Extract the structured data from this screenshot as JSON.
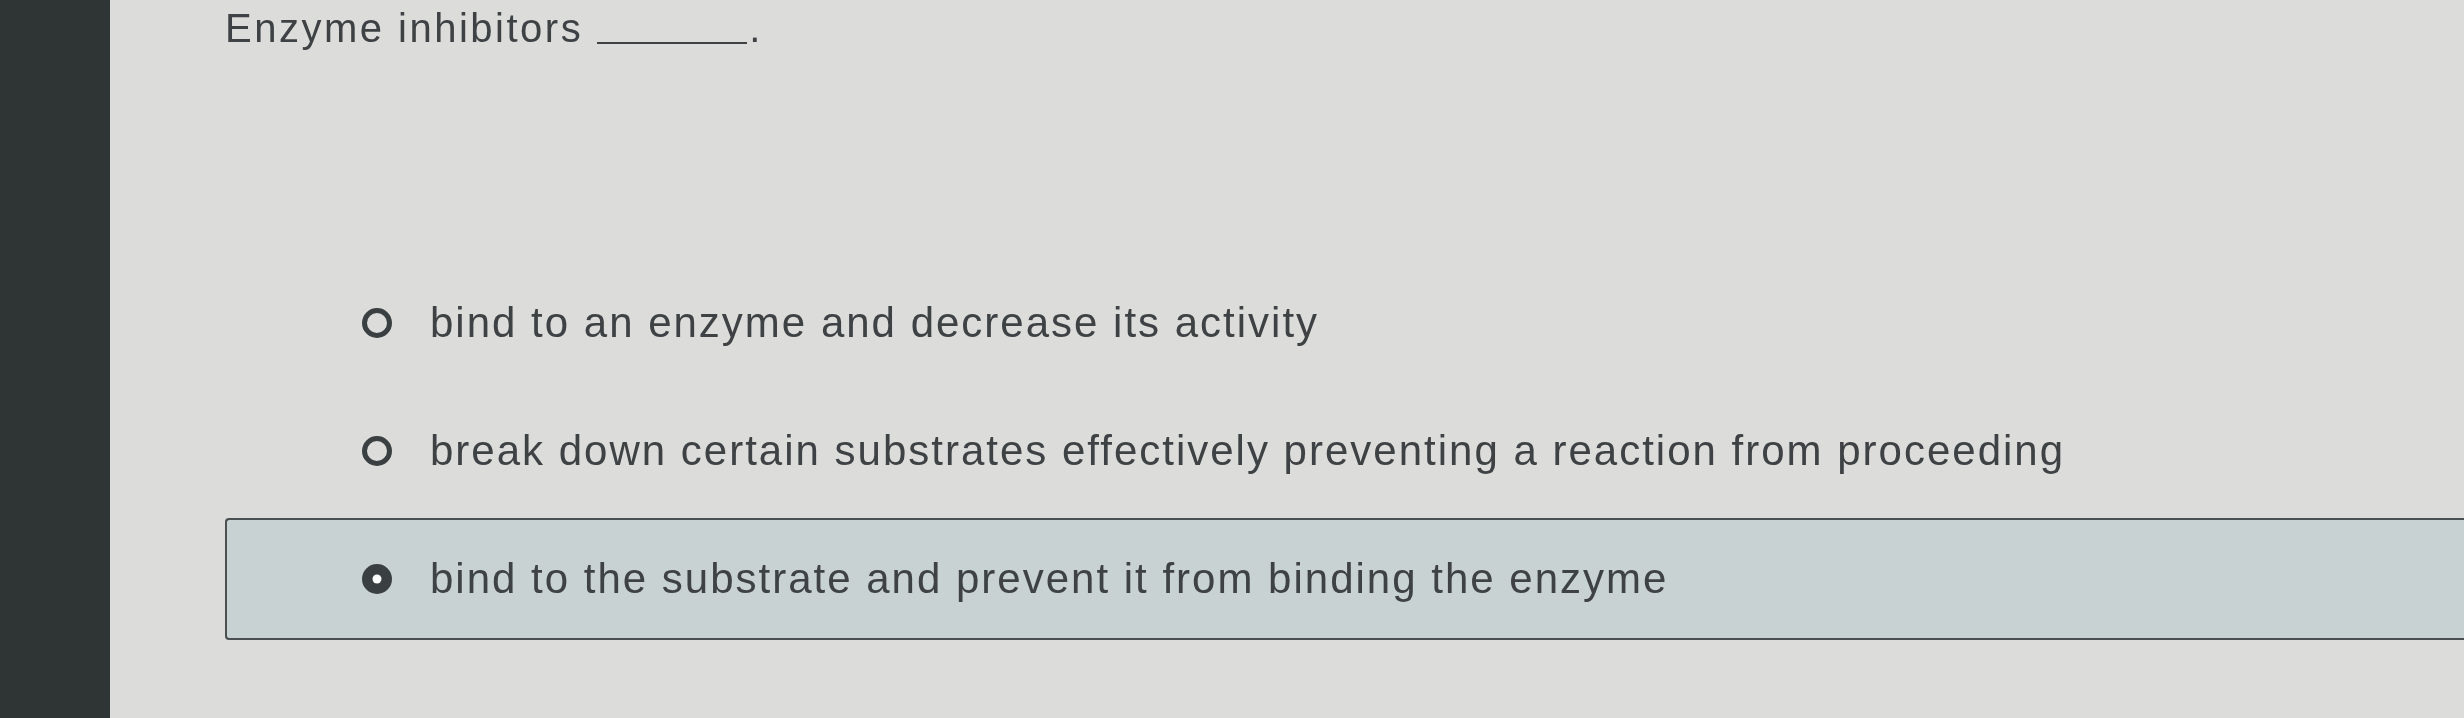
{
  "question": {
    "stem": "Enzyme inhibitors",
    "end": "."
  },
  "options": [
    {
      "text": "bind to an enzyme and decrease its activity",
      "selected": false
    },
    {
      "text": "break down certain substrates effectively preventing a reaction from proceeding",
      "selected": false
    },
    {
      "text": "bind to the substrate and prevent it from binding the enzyme",
      "selected": true
    }
  ]
}
